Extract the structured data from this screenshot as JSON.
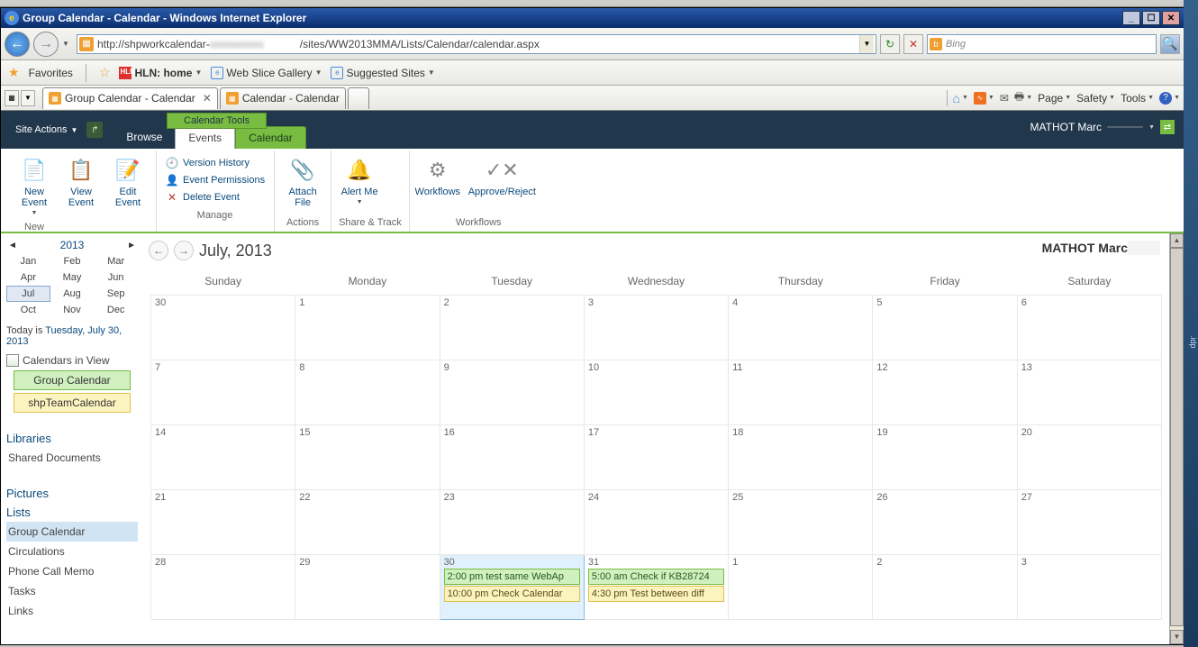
{
  "taskbar_remnants": [
    "Web Slice Gallery",
    "Suggested Sites"
  ],
  "window": {
    "title": "Group Calendar - Calendar - Windows Internet Explorer"
  },
  "address": {
    "prefix": "http://shpworkcalendar-",
    "suffix": "/sites/WW2013MMA/Lists/Calendar/calendar.aspx"
  },
  "search": {
    "engine": "Bing"
  },
  "favorites": {
    "label": "Favorites",
    "hln": "HLN: home",
    "webslice": "Web Slice Gallery",
    "suggested": "Suggested Sites"
  },
  "tabs": {
    "tab1": "Group Calendar - Calendar",
    "tab2": "Calendar - Calendar"
  },
  "tab_tools": {
    "page": "Page",
    "safety": "Safety",
    "tools": "Tools"
  },
  "sp": {
    "site_actions": "Site Actions",
    "browse": "Browse",
    "ctx_label": "Calendar Tools",
    "events_tab": "Events",
    "calendar_tab": "Calendar",
    "user": "MATHOT Marc"
  },
  "ribbon": {
    "new": {
      "label": "New",
      "new_event": "New Event",
      "view_event": "View Event",
      "edit_event": "Edit Event"
    },
    "manage": {
      "label": "Manage",
      "vh": "Version History",
      "ep": "Event Permissions",
      "de": "Delete Event"
    },
    "actions": {
      "label": "Actions",
      "attach": "Attach File"
    },
    "share": {
      "label": "Share & Track",
      "alert": "Alert Me"
    },
    "wf": {
      "label": "Workflows",
      "wf": "Workflows",
      "ar": "Approve/Reject"
    }
  },
  "minical": {
    "year": "2013",
    "months": [
      "Jan",
      "Feb",
      "Mar",
      "Apr",
      "May",
      "Jun",
      "Jul",
      "Aug",
      "Sep",
      "Oct",
      "Nov",
      "Dec"
    ],
    "selected": "Jul"
  },
  "today": {
    "prefix": "Today is ",
    "date": "Tuesday, July 30, 2013"
  },
  "civ": {
    "head": "Calendars in View",
    "group": "Group Calendar",
    "team": "shpTeamCalendar"
  },
  "nav": {
    "libraries": "Libraries",
    "shared_docs": "Shared Documents",
    "pictures": "Pictures",
    "lists": "Lists",
    "group_cal": "Group Calendar",
    "circ": "Circulations",
    "phone": "Phone Call Memo",
    "tasks": "Tasks",
    "links": "Links"
  },
  "calendar": {
    "title": "July, 2013",
    "user_right": "MATHOT Marc",
    "dow": [
      "Sunday",
      "Monday",
      "Tuesday",
      "Wednesday",
      "Thursday",
      "Friday",
      "Saturday"
    ],
    "weeks": [
      [
        {
          "n": "30",
          "dim": true
        },
        {
          "n": "1"
        },
        {
          "n": "2"
        },
        {
          "n": "3"
        },
        {
          "n": "4"
        },
        {
          "n": "5"
        },
        {
          "n": "6"
        }
      ],
      [
        {
          "n": "7"
        },
        {
          "n": "8"
        },
        {
          "n": "9"
        },
        {
          "n": "10"
        },
        {
          "n": "11"
        },
        {
          "n": "12"
        },
        {
          "n": "13"
        }
      ],
      [
        {
          "n": "14"
        },
        {
          "n": "15"
        },
        {
          "n": "16"
        },
        {
          "n": "17"
        },
        {
          "n": "18"
        },
        {
          "n": "19"
        },
        {
          "n": "20"
        }
      ],
      [
        {
          "n": "21"
        },
        {
          "n": "22"
        },
        {
          "n": "23"
        },
        {
          "n": "24"
        },
        {
          "n": "25"
        },
        {
          "n": "26"
        },
        {
          "n": "27"
        }
      ],
      [
        {
          "n": "28"
        },
        {
          "n": "29"
        },
        {
          "n": "30",
          "today": true,
          "events": [
            {
              "c": "green",
              "t": "2:00 pm test same WebAp"
            },
            {
              "c": "yellow",
              "t": "10:00 pm Check Calendar"
            }
          ]
        },
        {
          "n": "31",
          "events": [
            {
              "c": "green",
              "t": "5:00 am Check if KB28724"
            },
            {
              "c": "yellow",
              "t": "4:30 pm Test between diff"
            }
          ]
        },
        {
          "n": "1",
          "dim": true
        },
        {
          "n": "2",
          "dim": true
        },
        {
          "n": "3",
          "dim": true
        }
      ]
    ]
  },
  "right_strip": ".idp"
}
